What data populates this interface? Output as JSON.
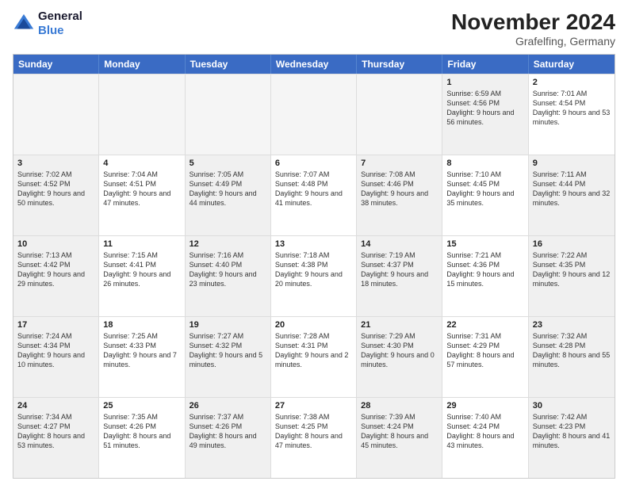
{
  "logo": {
    "line1": "General",
    "line2": "Blue"
  },
  "title": "November 2024",
  "subtitle": "Grafelfing, Germany",
  "days_of_week": [
    "Sunday",
    "Monday",
    "Tuesday",
    "Wednesday",
    "Thursday",
    "Friday",
    "Saturday"
  ],
  "rows": [
    [
      {
        "day": "",
        "text": "",
        "empty": true
      },
      {
        "day": "",
        "text": "",
        "empty": true
      },
      {
        "day": "",
        "text": "",
        "empty": true
      },
      {
        "day": "",
        "text": "",
        "empty": true
      },
      {
        "day": "",
        "text": "",
        "empty": true
      },
      {
        "day": "1",
        "text": "Sunrise: 6:59 AM\nSunset: 4:56 PM\nDaylight: 9 hours and 56 minutes.",
        "shaded": true
      },
      {
        "day": "2",
        "text": "Sunrise: 7:01 AM\nSunset: 4:54 PM\nDaylight: 9 hours and 53 minutes.",
        "shaded": false
      }
    ],
    [
      {
        "day": "3",
        "text": "Sunrise: 7:02 AM\nSunset: 4:52 PM\nDaylight: 9 hours and 50 minutes.",
        "shaded": true
      },
      {
        "day": "4",
        "text": "Sunrise: 7:04 AM\nSunset: 4:51 PM\nDaylight: 9 hours and 47 minutes.",
        "shaded": false
      },
      {
        "day": "5",
        "text": "Sunrise: 7:05 AM\nSunset: 4:49 PM\nDaylight: 9 hours and 44 minutes.",
        "shaded": true
      },
      {
        "day": "6",
        "text": "Sunrise: 7:07 AM\nSunset: 4:48 PM\nDaylight: 9 hours and 41 minutes.",
        "shaded": false
      },
      {
        "day": "7",
        "text": "Sunrise: 7:08 AM\nSunset: 4:46 PM\nDaylight: 9 hours and 38 minutes.",
        "shaded": true
      },
      {
        "day": "8",
        "text": "Sunrise: 7:10 AM\nSunset: 4:45 PM\nDaylight: 9 hours and 35 minutes.",
        "shaded": false
      },
      {
        "day": "9",
        "text": "Sunrise: 7:11 AM\nSunset: 4:44 PM\nDaylight: 9 hours and 32 minutes.",
        "shaded": true
      }
    ],
    [
      {
        "day": "10",
        "text": "Sunrise: 7:13 AM\nSunset: 4:42 PM\nDaylight: 9 hours and 29 minutes.",
        "shaded": true
      },
      {
        "day": "11",
        "text": "Sunrise: 7:15 AM\nSunset: 4:41 PM\nDaylight: 9 hours and 26 minutes.",
        "shaded": false
      },
      {
        "day": "12",
        "text": "Sunrise: 7:16 AM\nSunset: 4:40 PM\nDaylight: 9 hours and 23 minutes.",
        "shaded": true
      },
      {
        "day": "13",
        "text": "Sunrise: 7:18 AM\nSunset: 4:38 PM\nDaylight: 9 hours and 20 minutes.",
        "shaded": false
      },
      {
        "day": "14",
        "text": "Sunrise: 7:19 AM\nSunset: 4:37 PM\nDaylight: 9 hours and 18 minutes.",
        "shaded": true
      },
      {
        "day": "15",
        "text": "Sunrise: 7:21 AM\nSunset: 4:36 PM\nDaylight: 9 hours and 15 minutes.",
        "shaded": false
      },
      {
        "day": "16",
        "text": "Sunrise: 7:22 AM\nSunset: 4:35 PM\nDaylight: 9 hours and 12 minutes.",
        "shaded": true
      }
    ],
    [
      {
        "day": "17",
        "text": "Sunrise: 7:24 AM\nSunset: 4:34 PM\nDaylight: 9 hours and 10 minutes.",
        "shaded": true
      },
      {
        "day": "18",
        "text": "Sunrise: 7:25 AM\nSunset: 4:33 PM\nDaylight: 9 hours and 7 minutes.",
        "shaded": false
      },
      {
        "day": "19",
        "text": "Sunrise: 7:27 AM\nSunset: 4:32 PM\nDaylight: 9 hours and 5 minutes.",
        "shaded": true
      },
      {
        "day": "20",
        "text": "Sunrise: 7:28 AM\nSunset: 4:31 PM\nDaylight: 9 hours and 2 minutes.",
        "shaded": false
      },
      {
        "day": "21",
        "text": "Sunrise: 7:29 AM\nSunset: 4:30 PM\nDaylight: 9 hours and 0 minutes.",
        "shaded": true
      },
      {
        "day": "22",
        "text": "Sunrise: 7:31 AM\nSunset: 4:29 PM\nDaylight: 8 hours and 57 minutes.",
        "shaded": false
      },
      {
        "day": "23",
        "text": "Sunrise: 7:32 AM\nSunset: 4:28 PM\nDaylight: 8 hours and 55 minutes.",
        "shaded": true
      }
    ],
    [
      {
        "day": "24",
        "text": "Sunrise: 7:34 AM\nSunset: 4:27 PM\nDaylight: 8 hours and 53 minutes.",
        "shaded": true
      },
      {
        "day": "25",
        "text": "Sunrise: 7:35 AM\nSunset: 4:26 PM\nDaylight: 8 hours and 51 minutes.",
        "shaded": false
      },
      {
        "day": "26",
        "text": "Sunrise: 7:37 AM\nSunset: 4:26 PM\nDaylight: 8 hours and 49 minutes.",
        "shaded": true
      },
      {
        "day": "27",
        "text": "Sunrise: 7:38 AM\nSunset: 4:25 PM\nDaylight: 8 hours and 47 minutes.",
        "shaded": false
      },
      {
        "day": "28",
        "text": "Sunrise: 7:39 AM\nSunset: 4:24 PM\nDaylight: 8 hours and 45 minutes.",
        "shaded": true
      },
      {
        "day": "29",
        "text": "Sunrise: 7:40 AM\nSunset: 4:24 PM\nDaylight: 8 hours and 43 minutes.",
        "shaded": false
      },
      {
        "day": "30",
        "text": "Sunrise: 7:42 AM\nSunset: 4:23 PM\nDaylight: 8 hours and 41 minutes.",
        "shaded": true
      }
    ]
  ]
}
